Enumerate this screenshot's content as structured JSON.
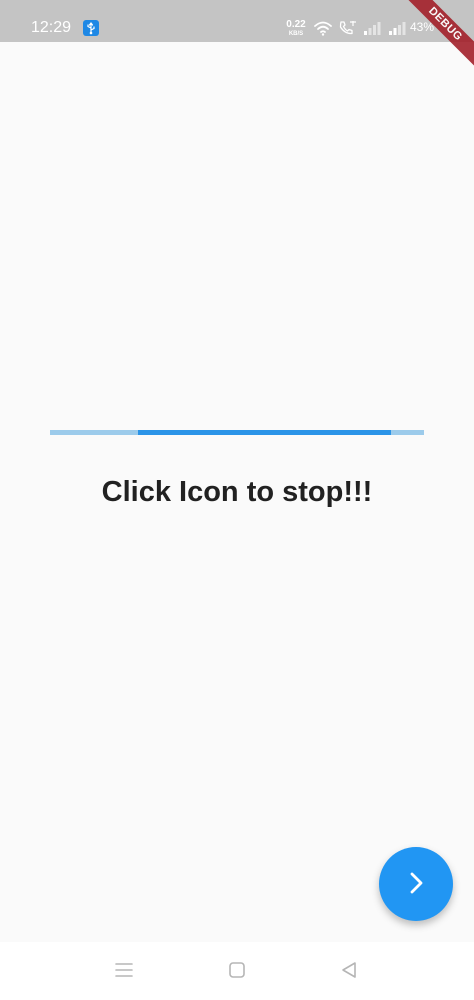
{
  "status_bar": {
    "time": "12:29",
    "net_speed_value": "0.22",
    "net_speed_unit": "KB/S",
    "battery": "43%",
    "icons": [
      "usb-icon",
      "wifi-icon",
      "call-icon",
      "signal-icon",
      "signal-icon"
    ]
  },
  "debug_banner": {
    "label": "DEBUG",
    "color": "#a3212b"
  },
  "progress": {
    "start_fraction": 0.234,
    "end_fraction": 0.912,
    "track_color": "#9ccbeb",
    "fill_color": "#2b94e8"
  },
  "main": {
    "message": "Click Icon to stop!!!"
  },
  "fab": {
    "icon": "chevron-right-icon",
    "color": "#2196f3"
  },
  "nav_bar": {
    "icons": [
      "menu-icon",
      "home-icon",
      "back-icon"
    ]
  }
}
